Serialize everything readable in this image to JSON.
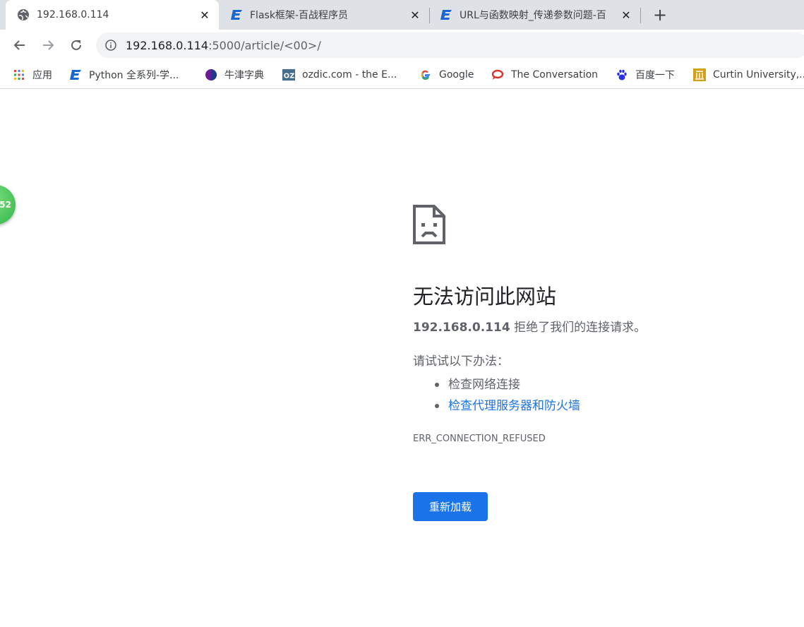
{
  "tabs": [
    {
      "title": "192.168.0.114",
      "icon": "globe-icon",
      "active": true
    },
    {
      "title": "Flask框架-百战程序员",
      "icon": "bz-logo-icon",
      "active": false
    },
    {
      "title": "URL与函数映射_传递参数问题-百",
      "icon": "bz-logo-icon",
      "active": false
    }
  ],
  "toolbar": {
    "back": "back-arrow-icon",
    "forward": "forward-arrow-icon",
    "reload": "reload-icon",
    "url_host": "192.168.0.114",
    "url_rest": ":5000/article/<00>/"
  },
  "bookmarks": [
    {
      "label": "应用",
      "icon": "apps-grid-icon"
    },
    {
      "label": "Python 全系列-学...",
      "icon": "bz-logo-icon"
    },
    {
      "label": "牛津字典",
      "icon": "oxford-icon"
    },
    {
      "label": "ozdic.com - the E...",
      "icon": "oz-icon"
    },
    {
      "label": "Google",
      "icon": "google-icon"
    },
    {
      "label": "The Conversation",
      "icon": "conversation-icon"
    },
    {
      "label": "百度一下",
      "icon": "baidu-paw-icon"
    },
    {
      "label": "Curtin University,...",
      "icon": "curtin-icon"
    }
  ],
  "floatball": {
    "text": "52"
  },
  "error": {
    "title": "无法访问此网站",
    "host": "192.168.0.114",
    "message": " 拒绝了我们的连接请求。",
    "suggest_head": "请试试以下办法：",
    "suggestions": [
      "检查网络连接",
      "检查代理服务器和防火墙"
    ],
    "code": "ERR_CONNECTION_REFUSED",
    "reload_label": "重新加载"
  },
  "colors": {
    "accent": "#1a73e8",
    "tabstrip": "#dee1e6",
    "text_muted": "#5f6368"
  }
}
